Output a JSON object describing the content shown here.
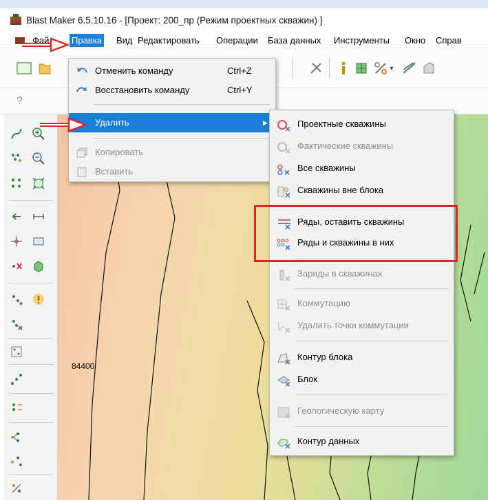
{
  "window": {
    "title": "Blast Maker 6.5.10.16 - [Проект: 200_пр (Режим проектных скважин) ]"
  },
  "menubar": {
    "items": [
      {
        "label": "Файл"
      },
      {
        "label": "Правка"
      },
      {
        "label": "Вид"
      },
      {
        "label": "Редактировать"
      },
      {
        "label": "Операции"
      },
      {
        "label": "База данных"
      },
      {
        "label": "Инструменты"
      },
      {
        "label": "Окно"
      },
      {
        "label": "Справ"
      }
    ]
  },
  "toolbar": {
    "help_glyph": "?"
  },
  "edit_menu": {
    "undo": {
      "label": "Отменить команду",
      "shortcut": "Ctrl+Z",
      "icon": "undo-icon"
    },
    "redo": {
      "label": "Восстановить команду",
      "shortcut": "Ctrl+Y",
      "icon": "redo-icon"
    },
    "delete": {
      "label": "Удалить",
      "icon": "submenu-arrow"
    },
    "copy": {
      "label": "Копировать",
      "icon": "copy-icon"
    },
    "paste": {
      "label": "Вставить",
      "icon": "paste-icon"
    }
  },
  "delete_submenu": {
    "items": [
      {
        "label": "Проектные скважины",
        "disabled": false,
        "icon": "design-holes-icon"
      },
      {
        "label": "Фактические скважины",
        "disabled": true,
        "icon": "actual-holes-icon"
      },
      {
        "label": "Все скважины",
        "disabled": false,
        "icon": "all-holes-icon"
      },
      {
        "label": "Скважины вне блока",
        "disabled": false,
        "icon": "holes-outside-block-icon"
      },
      {
        "label": "Ряды, оставить скважины",
        "disabled": false,
        "icon": "rows-keep-holes-icon"
      },
      {
        "label": "Ряды и скважины в них",
        "disabled": false,
        "icon": "rows-and-holes-icon"
      },
      {
        "label": "Заряды в скважинах",
        "disabled": true,
        "icon": "charges-icon"
      },
      {
        "label": "Коммутацию",
        "disabled": true,
        "icon": "tie-up-icon"
      },
      {
        "label": "Удалить точки коммутации",
        "disabled": true,
        "icon": "tie-points-icon"
      },
      {
        "label": "Контур блока",
        "disabled": false,
        "icon": "block-outline-icon"
      },
      {
        "label": "Блок",
        "disabled": false,
        "icon": "block-icon"
      },
      {
        "label": "Геологическую карту",
        "disabled": true,
        "icon": "geo-map-icon"
      },
      {
        "label": "Контур данных",
        "disabled": false,
        "icon": "data-outline-icon"
      }
    ]
  },
  "map": {
    "coordinate_label": "84400"
  },
  "colors": {
    "menu_highlight": "#1a7fd8",
    "annotation_red": "#e02424"
  }
}
